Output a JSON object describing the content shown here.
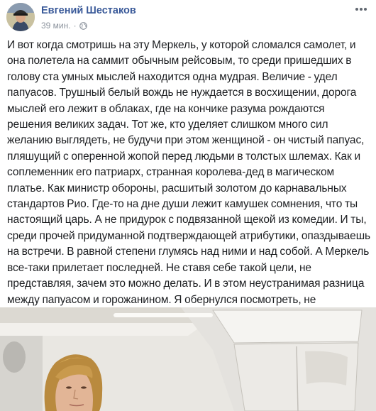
{
  "post": {
    "author": "Евгений Шестаков",
    "time": "39 мин.",
    "separator": "·",
    "text": "И вот когда смотришь на эту Меркель, у которой сломался самолет, и она полетела на саммит обычным рейсовым, то среди пришедших в голову ста умных мыслей находится одна мудрая. Величие - удел папуасов. Трушный белый вождь не нуждается в восхищении, дорога мыслей его лежит в облаках, где на кончике разума рождаются решения великих задач. Тот же, кто уделяет слишком много сил желанию выглядеть, не будучи при этом женщиной - он чистый папуас, пляшущий с оперенной жопой перед людьми в толстых шлемах. Как и соплеменник его патриарх, странная королева-дед в магическом платье. Как министр обороны, расшитый золотом до карнавальных стандартов Рио. Где-то на дне души лежит камушек сомнения, что ты настоящий царь. А не придурок с подвязанной щекой из комедии. И ты, среди прочей придуманной подтверждающей атрибутики, опаздываешь на встречи. В равной степени глумясь над ними и над собой. А Меркель все-таки прилетает последней. Не ставя себе такой цели, не представляя, зачем это можно делать. И в этом неустранимая разница между папуасом и горожанином. Я обернулся посмотреть, не обосрался ли я сам, когда насрал на тех, кому насрать на понт."
  },
  "icons": {
    "privacy": "globe-icon",
    "options": "more-options-icon"
  },
  "colors": {
    "author_link": "#385898",
    "meta_text": "#8d949e",
    "body_text": "#1c1e21"
  }
}
